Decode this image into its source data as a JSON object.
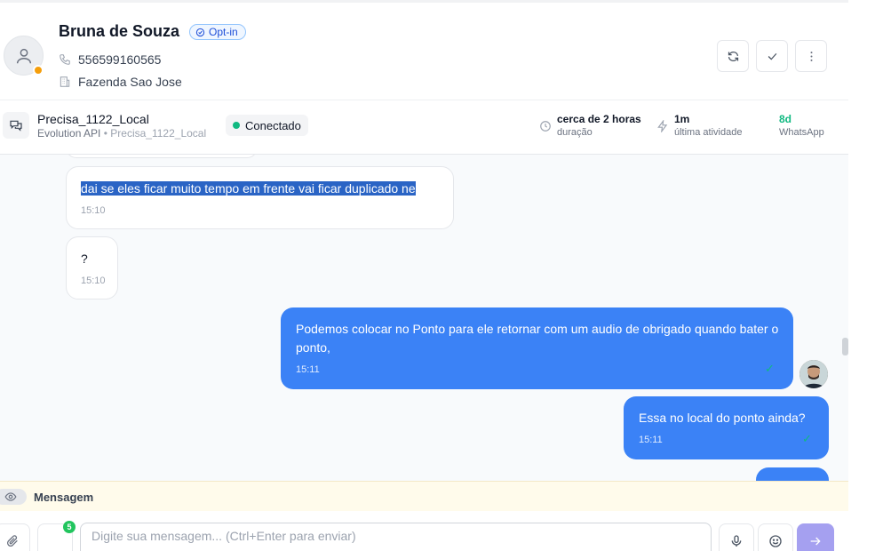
{
  "contact": {
    "name": "Bruna de Souza",
    "badge": "Opt-in",
    "phone": "556599160565",
    "company": "Fazenda Sao Jose"
  },
  "connection": {
    "instance": "Precisa_1122_Local",
    "provider": "Evolution API",
    "instance_sub": "Precisa_1122_Local",
    "status": "Conectado",
    "duration_value": "cerca de 2 horas",
    "duration_label": "duração",
    "activity_value": "1m",
    "activity_label": "última atividade",
    "channel_value": "8d",
    "channel_label": "WhatsApp"
  },
  "messages": [
    {
      "direction": "in",
      "text": "dai se eles ficar muito tempo em frente vai ficar duplicado ne",
      "time": "15:10",
      "selected": true
    },
    {
      "direction": "in",
      "text": "?",
      "time": "15:10"
    },
    {
      "direction": "out",
      "text": "Podemos colocar no Ponto para ele retornar com um audio de obrigado quando bater o ponto,",
      "time": "15:11"
    },
    {
      "direction": "out",
      "text": "Essa no local do ponto ainda?",
      "time": "15:11"
    }
  ],
  "composer": {
    "mode_label": "Mensagem",
    "placeholder": "Digite sua mensagem... (Ctrl+Enter para enviar)",
    "attachment_count": "5"
  },
  "colors": {
    "accent": "#3b82f6",
    "online": "#10b981",
    "away": "#f59e0b",
    "send": "#a5a0f0"
  }
}
